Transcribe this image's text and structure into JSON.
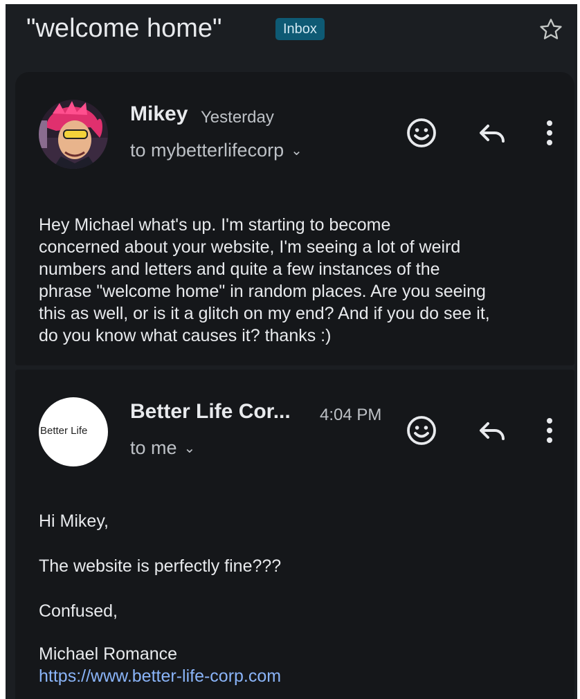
{
  "thread": {
    "subject": "\"welcome home\"",
    "label": "Inbox"
  },
  "messages": [
    {
      "sender": "Mikey",
      "time": "Yesterday",
      "recipient": "to mybetterlifecorp",
      "body": [
        "Hey Michael what's up. I'm starting to become",
        "concerned about your website, I'm seeing a lot of weird",
        "numbers and letters and quite a few instances of the",
        "phrase \"welcome home\" in random places. Are you seeing",
        "this as well, or is it a glitch on my end? And if you do see it,",
        "do you know what causes it? thanks :)"
      ]
    },
    {
      "sender": "Better Life Cor...",
      "time": "4:04 PM",
      "recipient": "to me",
      "avatar_text": "Better Life",
      "greeting": "Hi Mikey,",
      "line1": "The website is perfectly fine???",
      "line2": "Confused,",
      "signature": "Michael Romance",
      "link": "https://www.better-life-corp.com"
    }
  ],
  "icons": {
    "star": "star-outline-icon",
    "emoji": "add-reaction-icon",
    "reply": "reply-icon",
    "more": "more-vert-icon",
    "chevron": "chevron-down-icon"
  },
  "colors": {
    "background": "#1b1e22",
    "card": "#15171a",
    "label_chip": "#0e5a74",
    "link": "#8ab4f8"
  }
}
